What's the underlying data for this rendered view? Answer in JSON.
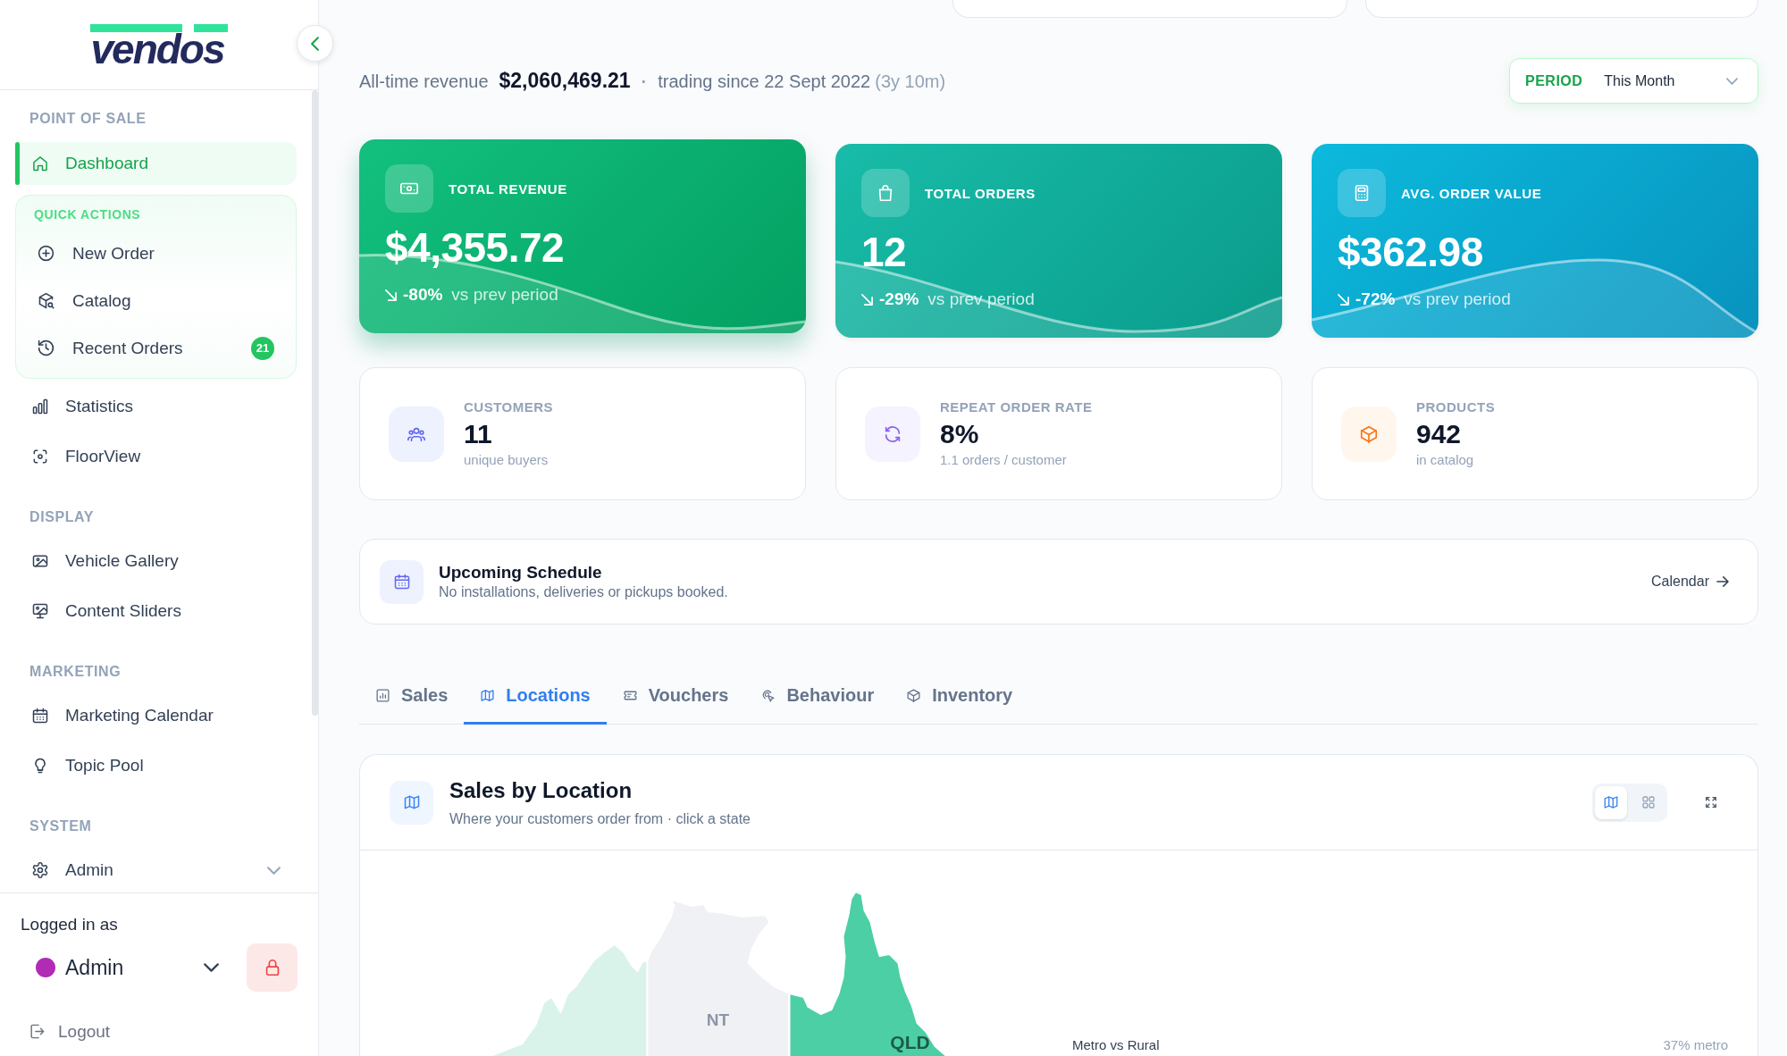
{
  "sidebar": {
    "logo": "vendos",
    "sections": [
      {
        "heading": "POINT OF SALE",
        "items": [
          {
            "kind": "link",
            "label": "Dashboard",
            "selected": true
          },
          {
            "kind": "group",
            "heading": "QUICK ACTIONS",
            "items": [
              {
                "label": "New Order"
              },
              {
                "label": "Catalog"
              },
              {
                "label": "Recent Orders",
                "badge": "21"
              }
            ]
          },
          {
            "kind": "link",
            "label": "Statistics",
            "selected": false
          },
          {
            "kind": "link",
            "label": "FloorView",
            "selected": false
          }
        ]
      },
      {
        "heading": "DISPLAY",
        "items": [
          {
            "kind": "link",
            "label": "Vehicle Gallery",
            "selected": false
          },
          {
            "kind": "link",
            "label": "Content Sliders",
            "selected": false
          }
        ]
      },
      {
        "heading": "MARKETING",
        "items": [
          {
            "kind": "link",
            "label": "Marketing Calendar",
            "selected": false
          },
          {
            "kind": "link",
            "label": "Topic Pool",
            "selected": false
          }
        ]
      },
      {
        "heading": "SYSTEM",
        "items": [
          {
            "kind": "link",
            "label": "Admin",
            "selected": false,
            "expanded": false
          }
        ]
      }
    ],
    "account": {
      "caption": "Logged in as",
      "name": "Admin",
      "expanded": false
    },
    "logout": "Logout"
  },
  "summary": {
    "label": "All-time revenue",
    "value": "$2,060,469.21",
    "separator": "·",
    "since": "trading since 22 Sept 2022",
    "duration": "(3y 10m)"
  },
  "period": {
    "label": "PERIOD",
    "value": "This Month",
    "expanded": false
  },
  "kpi_cards": [
    {
      "label": "TOTAL REVENUE",
      "value": "$4,355.72",
      "declining": true,
      "change": "-80%",
      "comparison": "vs prev period",
      "hovered": true
    },
    {
      "label": "TOTAL ORDERS",
      "value": "12",
      "declining": true,
      "change": "-29%",
      "comparison": "vs prev period",
      "hovered": false
    },
    {
      "label": "AVG. ORDER VALUE",
      "value": "$362.98",
      "declining": true,
      "change": "-72%",
      "comparison": "vs prev period",
      "hovered": false
    }
  ],
  "stat_cards": [
    {
      "label": "CUSTOMERS",
      "value": "11",
      "caption": "unique buyers"
    },
    {
      "label": "REPEAT ORDER RATE",
      "value": "8%",
      "caption": "1.1 orders / customer"
    },
    {
      "label": "PRODUCTS",
      "value": "942",
      "caption": "in catalog"
    }
  ],
  "schedule": {
    "title": "Upcoming Schedule",
    "message": "No installations, deliveries or pickups booked.",
    "link": "Calendar"
  },
  "tabs": [
    {
      "label": "Sales",
      "selected": false
    },
    {
      "label": "Locations",
      "selected": true
    },
    {
      "label": "Vouchers",
      "selected": false
    },
    {
      "label": "Behaviour",
      "selected": false
    },
    {
      "label": "Inventory",
      "selected": false
    }
  ],
  "location_panel": {
    "title": "Sales by Location",
    "subtitle": "Where your customers order from · click a state",
    "views": [
      {
        "selected": true
      },
      {
        "selected": false
      }
    ],
    "regions": [
      {
        "color": "#d9f3ea"
      },
      {
        "label": "NT",
        "color": "#eff1f5"
      },
      {
        "label": "QLD",
        "color": "#4ccfa5"
      }
    ],
    "metro_label": "Metro vs Rural",
    "metro_share": "37% metro"
  }
}
